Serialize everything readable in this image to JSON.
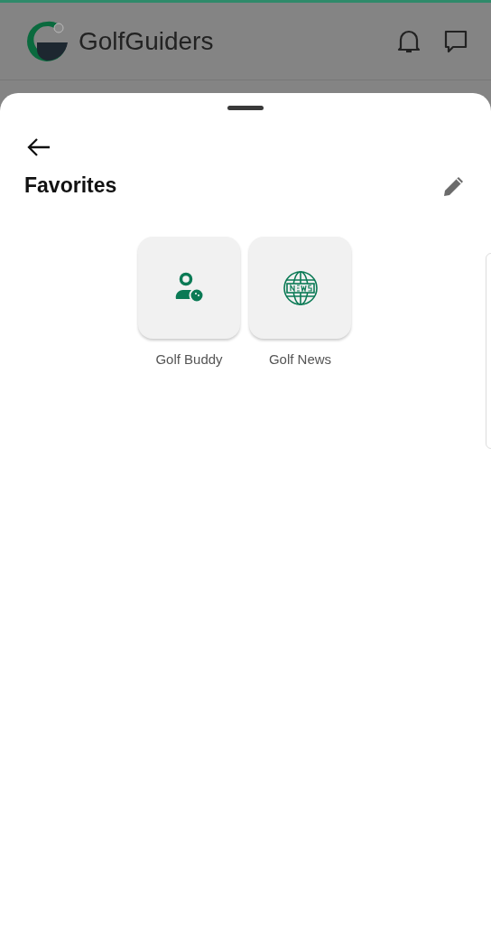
{
  "app_bar": {
    "title": "GolfGuiders"
  },
  "sheet": {
    "title": "Favorites"
  },
  "favorites": [
    {
      "label": "Golf Buddy",
      "kind": "buddy"
    },
    {
      "label": "Golf News",
      "kind": "news"
    }
  ]
}
